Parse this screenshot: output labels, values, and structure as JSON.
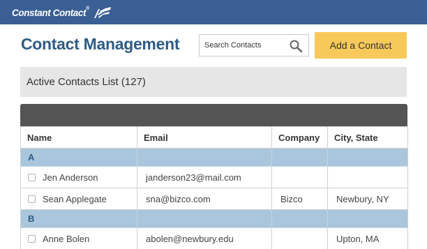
{
  "brand": {
    "name": "Constant Contact",
    "trademark": "®"
  },
  "header": {
    "title": "Contact Management"
  },
  "search": {
    "placeholder": "Search Contacts",
    "icon": "search-icon"
  },
  "actions": {
    "add_contact_label": "Add a Contact"
  },
  "list": {
    "title": "Active Contacts List (127)"
  },
  "table": {
    "columns": [
      "Name",
      "Email",
      "Company",
      "City, State"
    ],
    "groups": [
      {
        "letter": "A",
        "rows": [
          {
            "name": "Jen Anderson",
            "email": "janderson23@mail.com",
            "company": "",
            "city_state": ""
          },
          {
            "name": "Sean Applegate",
            "email": "sna@bizco.com",
            "company": "Bizco",
            "city_state": "Newbury, NY"
          }
        ]
      },
      {
        "letter": "B",
        "rows": [
          {
            "name": "Anne Bolen",
            "email": "abolen@newbury.edu",
            "company": "",
            "city_state": "Upton, MA"
          }
        ]
      }
    ]
  },
  "colors": {
    "topbar": "#3a5f95",
    "title": "#2f5b85",
    "add_button": "#f6c95a",
    "group_row": "#a9c6dc",
    "table_header_bar": "#545454"
  }
}
